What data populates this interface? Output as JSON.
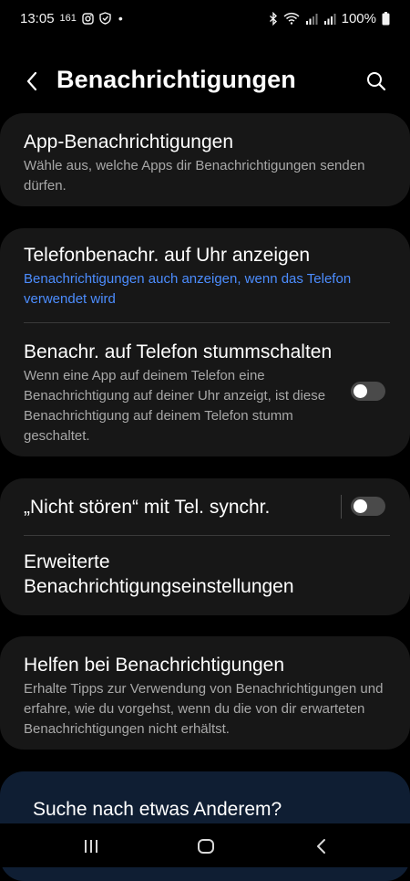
{
  "status_bar": {
    "time": "13:05",
    "extra_small": "161",
    "battery": "100%"
  },
  "header": {
    "title": "Benachrichtigungen"
  },
  "settings": {
    "app_notifications": {
      "title": "App-Benachrichtigungen",
      "subtitle": "Wähle aus, welche Apps dir Benachrichtigungen senden dürfen."
    },
    "phone_on_watch": {
      "title": "Telefonbenachr. auf Uhr anzeigen",
      "subtitle": "Benachrichtigungen auch anzeigen, wenn das Telefon verwendet wird"
    },
    "mute_on_phone": {
      "title": "Benachr. auf Telefon stummschalten",
      "subtitle": "Wenn eine App auf deinem Telefon eine Benachrichtigung auf deiner Uhr anzeigt, ist diese Benachrichtigung auf deinem Telefon stumm geschaltet.",
      "enabled": false
    },
    "dnd_sync": {
      "title": "„Nicht stören“ mit Tel. synchr.",
      "enabled": false
    },
    "advanced": {
      "title": "Erweiterte Benachrichtigungseinstellungen"
    },
    "help": {
      "title": "Helfen bei Benachrichtigungen",
      "subtitle": "Erhalte Tipps zur Verwendung von Benachrichtigungen und erfahre, wie du vorgehst, wenn du die von dir erwarteten Benachrichtigungen nicht erhältst."
    }
  },
  "search_card": {
    "label": "Suche nach etwas Anderem?"
  },
  "colors": {
    "background": "#000000",
    "card": "#171717",
    "accent_blue": "#4c8dff",
    "secondary_text": "#a8a8a8"
  }
}
